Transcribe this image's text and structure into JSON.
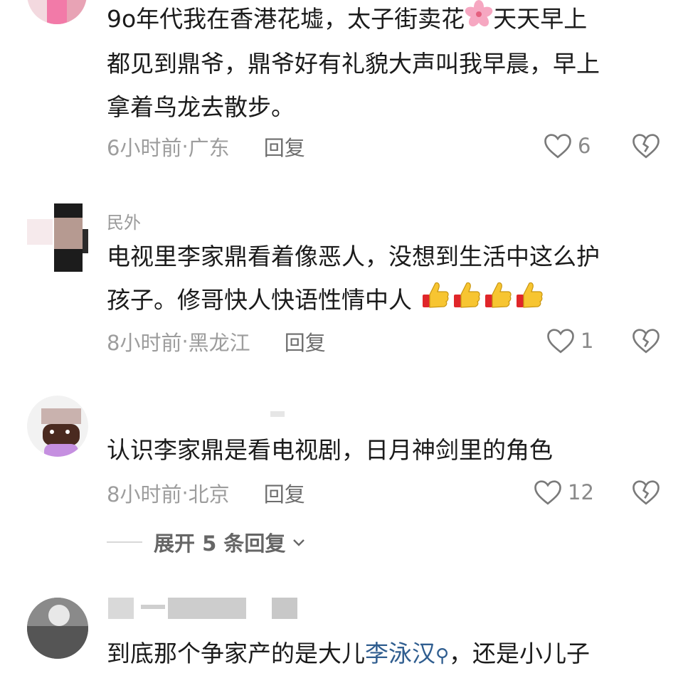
{
  "comments": [
    {
      "text_line1": "9o年代我在香港花墟，太子街卖花",
      "text_line1b": "天天早上",
      "text_line2": "都见到鼎爷，鼎爷好有礼貌大声叫我早晨，早上",
      "text_line3": "拿着鸟龙去散步。",
      "time": "6小时前",
      "location": "广东",
      "reply_label": "回复",
      "likes": "6"
    },
    {
      "username": "民外",
      "text_line1": "电视里李家鼎看着像恶人，没想到生活中这么护",
      "text_line2": "孩子。修哥快人快语性情中人",
      "time": "8小时前",
      "location": "黑龙江",
      "reply_label": "回复",
      "likes": "1"
    },
    {
      "text_line1": "认识李家鼎是看电视剧，日月神剑里的角色",
      "time": "8小时前",
      "location": "北京",
      "reply_label": "回复",
      "likes": "12",
      "expand_label": "展开 5 条回复"
    },
    {
      "text_start": "到底那个争家产的是大儿",
      "mention": "李泳汉",
      "text_end": "，还是小儿子"
    }
  ],
  "separator": " · ",
  "icons": {
    "like": "heart-outline-icon",
    "dislike": "broken-heart-icon",
    "flower": "cherry-blossom-emoji",
    "thumbs": "thumbs-up-emoji",
    "chevron": "chevron-down-icon"
  },
  "colors": {
    "text": "#1b1b1b",
    "meta": "#9d9d9d",
    "mention": "#2f5d8f"
  }
}
